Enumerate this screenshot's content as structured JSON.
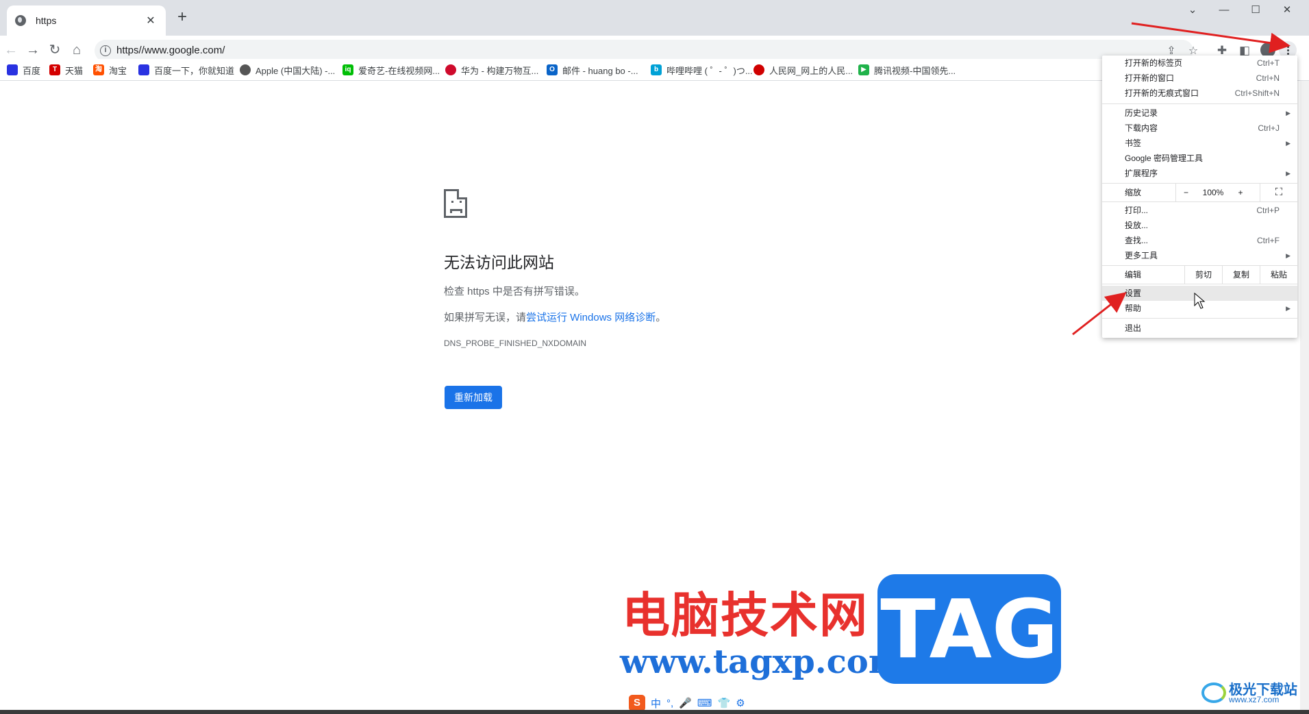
{
  "tab": {
    "title": "https"
  },
  "toolbar": {
    "url": "https//www.google.com/"
  },
  "bookmarks": [
    {
      "label": "百度",
      "color": "#2932e1",
      "glyph": "🐾"
    },
    {
      "label": "天猫",
      "color": "#d40000",
      "glyph": "T"
    },
    {
      "label": "淘宝",
      "color": "#ff5000",
      "glyph": "淘"
    },
    {
      "label": "百度一下，你就知道",
      "color": "#2932e1",
      "glyph": "🐾"
    },
    {
      "label": "Apple (中国大陆) -...",
      "color": "#555555",
      "glyph": ""
    },
    {
      "label": "爱奇艺-在线视频网...",
      "color": "#00be06",
      "glyph": "iq"
    },
    {
      "label": "华为 - 构建万物互...",
      "color": "#cf0a2c",
      "glyph": ""
    },
    {
      "label": "邮件 - huang bo -...",
      "color": "#0a64c8",
      "glyph": "O"
    },
    {
      "label": "哔哩哔哩 ( ゜- ゜)つ...",
      "color": "#00a1d6",
      "glyph": "b"
    },
    {
      "label": "人民网_网上的人民...",
      "color": "#d00000",
      "glyph": ""
    },
    {
      "label": "腾讯视频-中国领先...",
      "color": "#20b24a",
      "glyph": "▶"
    }
  ],
  "error": {
    "title": "无法访问此网站",
    "line1": "检查 https 中是否有拼写错误。",
    "line2_prefix": "如果拼写无误，请",
    "line2_link": "尝试运行 Windows 网络诊断",
    "line2_suffix": "。",
    "code": "DNS_PROBE_FINISHED_NXDOMAIN",
    "reload": "重新加载"
  },
  "menu": {
    "new_tab": "打开新的标签页",
    "new_tab_sc": "Ctrl+T",
    "new_window": "打开新的窗口",
    "new_window_sc": "Ctrl+N",
    "incognito": "打开新的无痕式窗口",
    "incognito_sc": "Ctrl+Shift+N",
    "history": "历史记录",
    "downloads": "下载内容",
    "downloads_sc": "Ctrl+J",
    "bookmarks": "书签",
    "passwords": "Google 密码管理工具",
    "extensions": "扩展程序",
    "zoom": "缩放",
    "zoom_minus": "−",
    "zoom_value": "100%",
    "zoom_plus": "+",
    "print": "打印...",
    "print_sc": "Ctrl+P",
    "cast": "投放...",
    "find": "查找...",
    "find_sc": "Ctrl+F",
    "more_tools": "更多工具",
    "edit": "编辑",
    "cut": "剪切",
    "copy": "复制",
    "paste": "粘贴",
    "settings": "设置",
    "help": "帮助",
    "exit": "退出"
  },
  "watermark": {
    "cn": "电脑技术网",
    "url": "www.tagxp.com",
    "tag": "TAG",
    "site_cn": "极光下载站",
    "site_url": "www.xz7.com"
  },
  "ime": {
    "s": "S",
    "mode": "中",
    "punct": "°,"
  }
}
